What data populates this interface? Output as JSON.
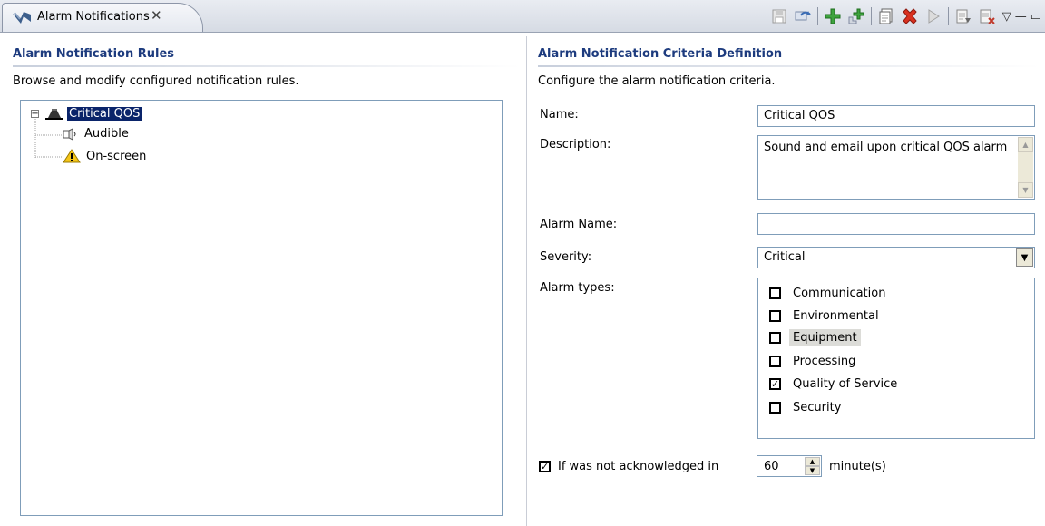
{
  "tab": {
    "title": "Alarm Notifications",
    "close_glyph": "✕"
  },
  "toolbar": {
    "icons": [
      "save-icon",
      "refresh-icon",
      "add-icon",
      "add-child-icon",
      "copy-icon",
      "delete-icon",
      "run-icon",
      "export-icon",
      "import-icon"
    ],
    "view_menu_glyph": "▽",
    "minimize_glyph": "—",
    "maximize_glyph": "▭"
  },
  "left": {
    "title": "Alarm Notification Rules",
    "description": "Browse and modify configured notification rules.",
    "tree": {
      "root": {
        "label": "Critical QOS",
        "expander": "−",
        "icon": "bell-icon"
      },
      "children": [
        {
          "label": "Audible",
          "icon": "speaker-icon"
        },
        {
          "label": "On-screen",
          "icon": "warning-icon"
        }
      ]
    }
  },
  "right": {
    "title": "Alarm Notification Criteria Definition",
    "description": "Configure the alarm notification criteria.",
    "name_label": "Name:",
    "name_value": "Critical QOS",
    "description_label": "Description:",
    "description_value": "Sound and email upon critical QOS alarm",
    "alarm_name_label": "Alarm Name:",
    "alarm_name_value": "",
    "severity_label": "Severity:",
    "severity_value": "Critical",
    "alarm_types_label": "Alarm types:",
    "alarm_types": [
      {
        "label": "Communication",
        "checked": false,
        "highlighted": false
      },
      {
        "label": "Environmental",
        "checked": false,
        "highlighted": false
      },
      {
        "label": "Equipment",
        "checked": false,
        "highlighted": true
      },
      {
        "label": "Processing",
        "checked": false,
        "highlighted": false
      },
      {
        "label": "Quality of Service",
        "checked": true,
        "highlighted": false
      },
      {
        "label": "Security",
        "checked": false,
        "highlighted": false
      }
    ],
    "ack": {
      "label": "If was not acknowledged in",
      "checked": true,
      "value": "60",
      "unit": "minute(s)"
    }
  },
  "colors": {
    "title_blue": "#1d3b7e",
    "selection": "#0a246a",
    "border": "#7f9db9"
  }
}
